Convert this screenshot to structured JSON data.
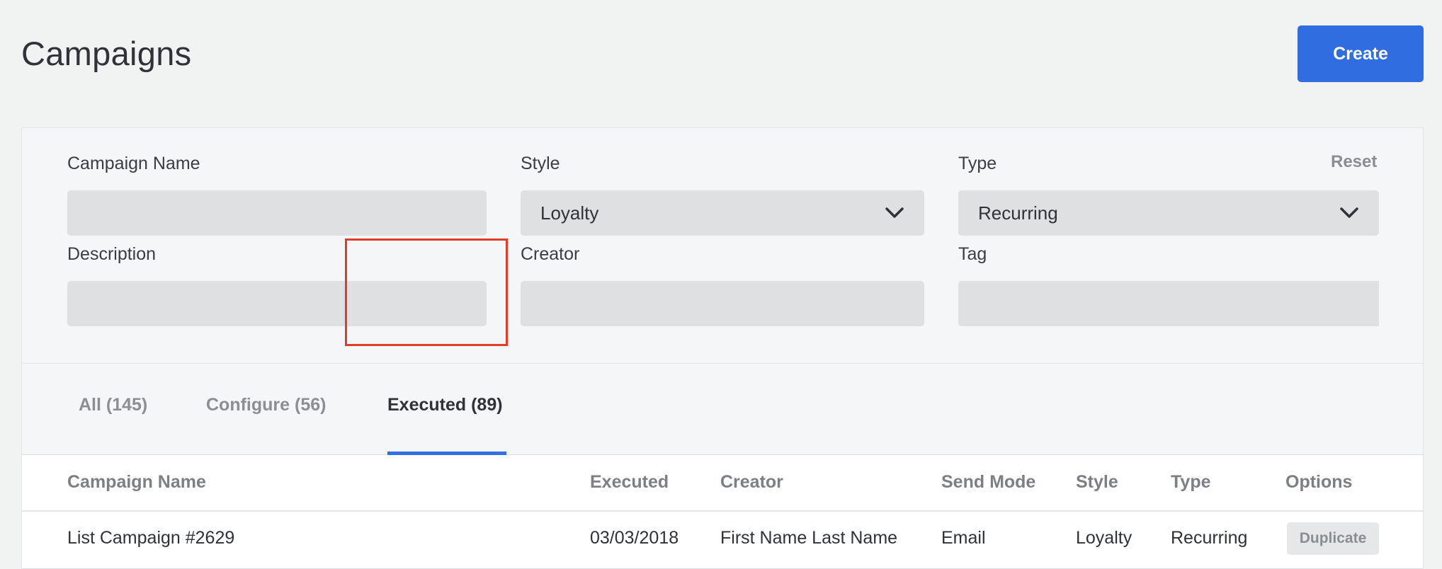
{
  "header": {
    "title": "Campaigns",
    "create_label": "Create"
  },
  "filters": {
    "campaign_name": {
      "label": "Campaign Name",
      "value": ""
    },
    "style": {
      "label": "Style",
      "value": "Loyalty"
    },
    "type": {
      "label": "Type",
      "value": "Recurring"
    },
    "description": {
      "label": "Description",
      "value": ""
    },
    "creator": {
      "label": "Creator",
      "value": ""
    },
    "tag": {
      "label": "Tag",
      "value": ""
    },
    "reset_label": "Reset"
  },
  "tabs": [
    {
      "label": "All (145)"
    },
    {
      "label": "Configure (56)"
    },
    {
      "label": "Executed (89)",
      "active": true
    }
  ],
  "table": {
    "columns": [
      "Campaign Name",
      "Executed",
      "Creator",
      "Send Mode",
      "Style",
      "Type",
      "Options"
    ],
    "rows": [
      {
        "campaign_name": "List Campaign #2629",
        "executed": "03/03/2018",
        "creator": "First Name Last Name",
        "send_mode": "Email",
        "style": "Loyalty",
        "type": "Recurring",
        "option_label": "Duplicate"
      }
    ]
  },
  "colors": {
    "accent": "#2f6de1",
    "highlight": "#e03c2a",
    "background": "#f1f2f2"
  }
}
